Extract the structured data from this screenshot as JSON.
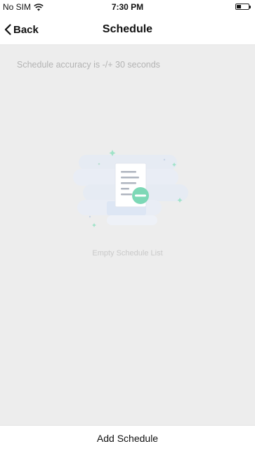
{
  "status_bar": {
    "carrier": "No SIM",
    "time": "7:30 PM",
    "battery_level": 0.35
  },
  "nav": {
    "back_label": "Back",
    "title": "Schedule"
  },
  "main": {
    "accuracy_note": "Schedule accuracy is -/+ 30 seconds",
    "empty_label": "Empty Schedule List"
  },
  "footer": {
    "add_label": "Add Schedule"
  },
  "colors": {
    "content_background": "#ededed",
    "accent": "#7dd8b6"
  }
}
